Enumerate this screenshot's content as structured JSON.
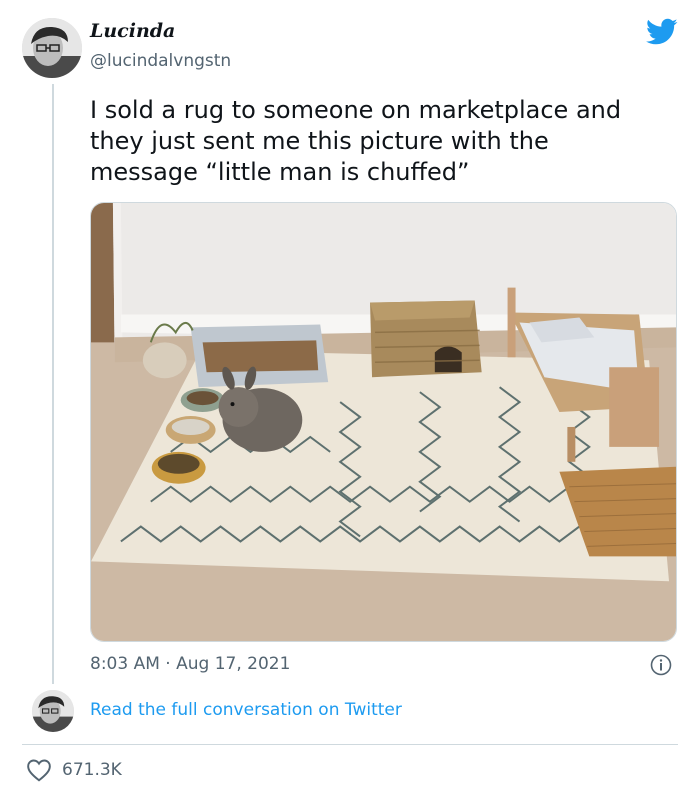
{
  "author": {
    "display_name": "Lucinda",
    "handle": "@lucindalvngstn"
  },
  "tweet": {
    "text_lines": [
      "I sold a rug to someone on marketplace and",
      "they just sent me this picture with the",
      "message “little man is chuffed”"
    ],
    "time": "8:03 AM",
    "separator": "·",
    "date": "Aug 17, 2021"
  },
  "conversation_link": "Read the full conversation on Twitter",
  "likes": {
    "count": "671.3K"
  },
  "colors": {
    "brand": "#1d9bf0",
    "text_primary": "#0f1419",
    "text_secondary": "#536471",
    "border": "#cfd9de"
  },
  "icons": {
    "brand": "twitter-bird-icon",
    "info": "info-icon",
    "like": "heart-icon"
  }
}
